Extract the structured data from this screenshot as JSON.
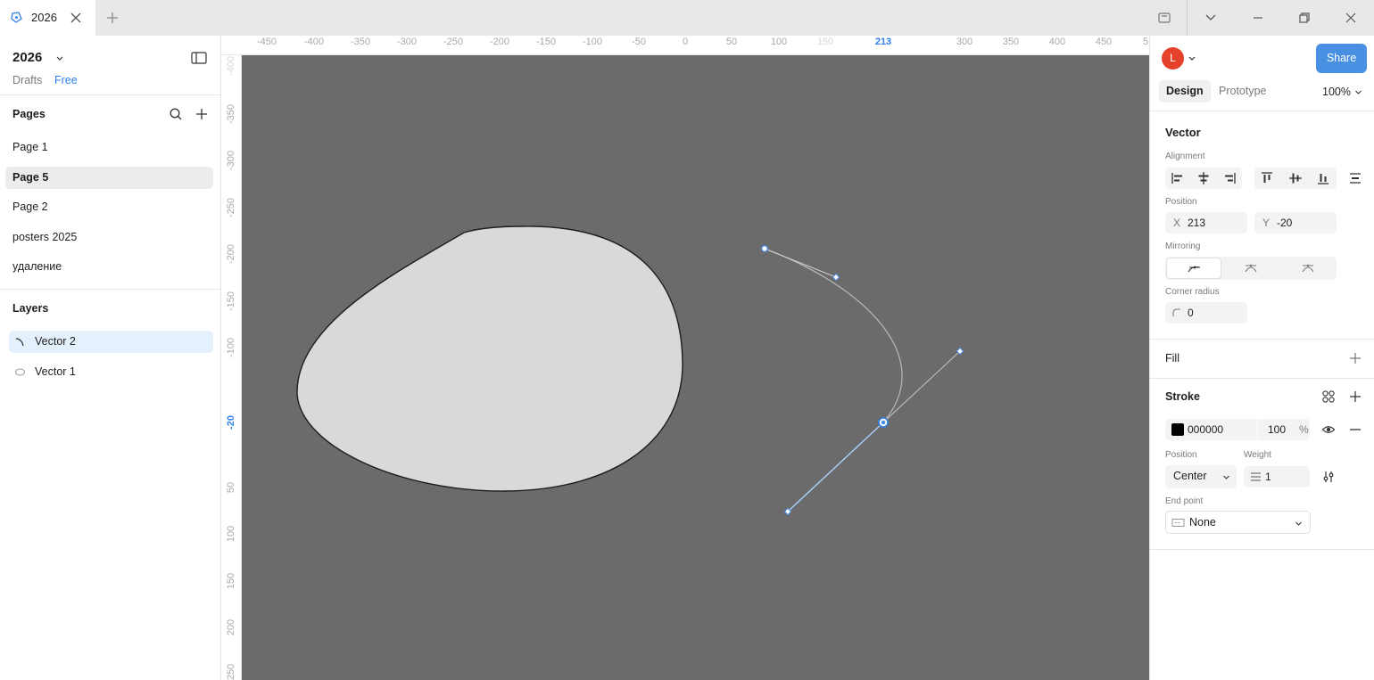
{
  "titlebar": {
    "tab_title": "2026"
  },
  "left": {
    "file_name": "2026",
    "drafts_label": "Drafts",
    "plan_label": "Free",
    "pages_title": "Pages",
    "pages": [
      {
        "label": "Page 1",
        "selected": false
      },
      {
        "label": "Page 5",
        "selected": true
      },
      {
        "label": "Page 2",
        "selected": false
      },
      {
        "label": "posters 2025",
        "selected": false
      },
      {
        "label": "удаление",
        "selected": false
      }
    ],
    "layers_title": "Layers",
    "layers": [
      {
        "label": "Vector 2",
        "icon": "open-path-icon",
        "selected": true
      },
      {
        "label": "Vector 1",
        "icon": "ellipse-icon",
        "selected": false
      }
    ]
  },
  "rulers": {
    "top": [
      "-450",
      "-400",
      "-350",
      "-300",
      "-250",
      "-200",
      "-150",
      "-100",
      "-50",
      "0",
      "50",
      "100",
      "150",
      "213",
      "300",
      "350",
      "400",
      "450",
      "5"
    ],
    "left": [
      "-400",
      "-350",
      "-300",
      "-250",
      "-200",
      "-150",
      "-100",
      "-20",
      "50",
      "100",
      "150",
      "200",
      "250"
    ]
  },
  "right": {
    "avatar_initial": "L",
    "share_label": "Share",
    "tabs": {
      "design": "Design",
      "prototype": "Prototype"
    },
    "zoom": "100%",
    "layer_type": "Vector",
    "alignment_label": "Alignment",
    "position_label": "Position",
    "x_label": "X",
    "x_value": "213",
    "y_label": "Y",
    "y_value": "-20",
    "mirroring_label": "Mirroring",
    "corner_radius_label": "Corner radius",
    "corner_radius_value": "0",
    "fill_title": "Fill",
    "stroke_title": "Stroke",
    "stroke_color": "000000",
    "stroke_opacity": "100",
    "stroke_opacity_unit": "%",
    "stroke_position_label": "Position",
    "stroke_position_value": "Center",
    "stroke_weight_label": "Weight",
    "stroke_weight_value": "1",
    "end_point_label": "End point",
    "end_point_value": "None"
  },
  "colors": {
    "accent": "#2f80ed",
    "share": "#4a90e2",
    "canvas": "#6b6b6b",
    "shape_fill": "#d9d9d9",
    "avatar": "#e5412b",
    "selection": "#e5f0fd"
  }
}
